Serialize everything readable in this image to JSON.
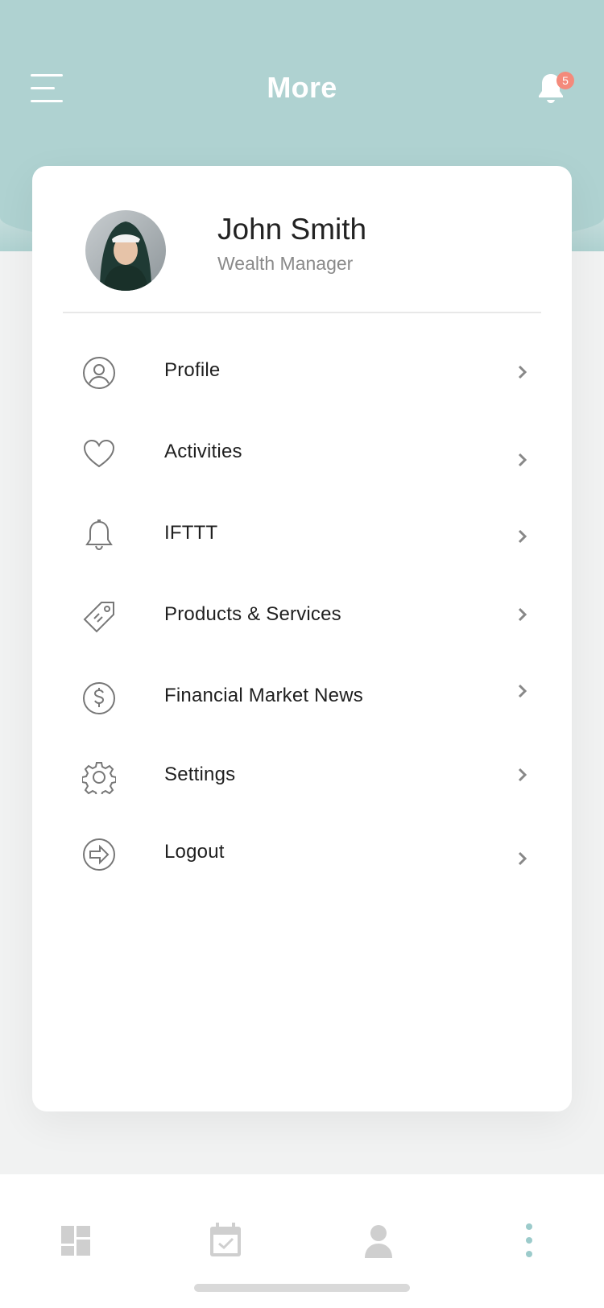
{
  "header": {
    "title": "More",
    "notification_count": "5"
  },
  "user": {
    "name": "John Smith",
    "role": "Wealth Manager"
  },
  "menu": [
    {
      "label": "Profile",
      "icon": "user-circle-icon"
    },
    {
      "label": "Activities",
      "icon": "heart-icon"
    },
    {
      "label": "IFTTT",
      "icon": "bell-icon"
    },
    {
      "label": "Products & Services",
      "icon": "tag-icon"
    },
    {
      "label": "Financial Market News",
      "icon": "dollar-circle-icon"
    },
    {
      "label": "Settings",
      "icon": "gear-icon"
    },
    {
      "label": "Logout",
      "icon": "logout-arrow-icon"
    }
  ],
  "bottom_nav": [
    {
      "icon": "dashboard-icon",
      "active": false
    },
    {
      "icon": "calendar-check-icon",
      "active": false
    },
    {
      "icon": "person-icon",
      "active": false
    },
    {
      "icon": "more-vertical-icon",
      "active": true
    }
  ],
  "colors": {
    "header": "#afd2d1",
    "badge": "#f48a7b",
    "active_nav": "#9ccbcb",
    "inactive_nav": "#cfcfcf"
  }
}
